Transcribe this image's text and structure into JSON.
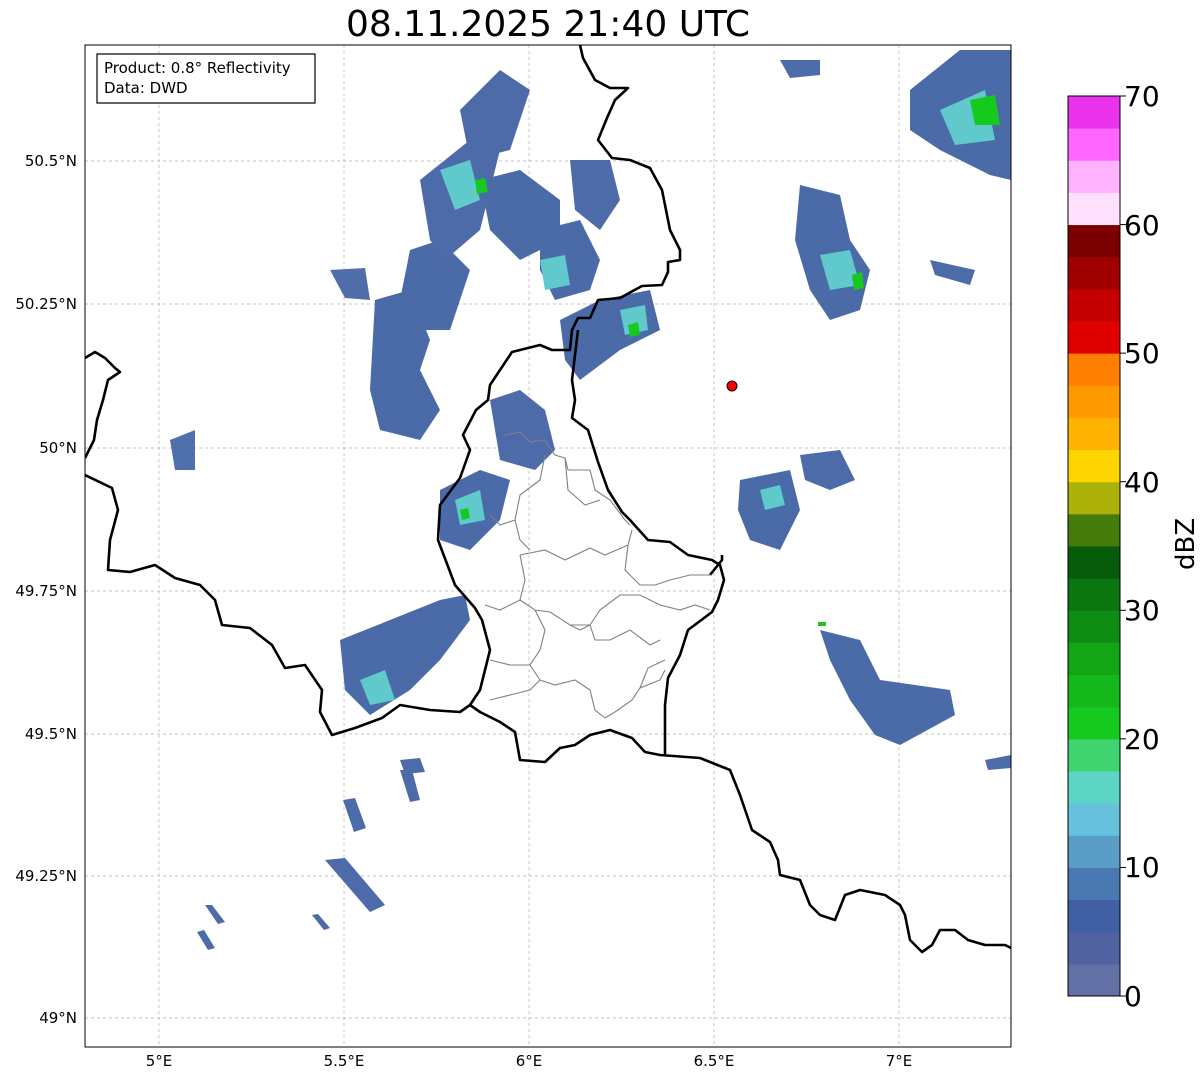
{
  "title": "08.11.2025 21:40 UTC",
  "info_box": {
    "product": "Product: 0.8° Reflectivity",
    "data": "Data: DWD"
  },
  "axes": {
    "x_ticks": [
      "5°E",
      "5.5°E",
      "6°E",
      "6.5°E",
      "7°E"
    ],
    "y_ticks": [
      "50.5°N",
      "50.25°N",
      "50°N",
      "49.75°N",
      "49.5°N",
      "49.25°N",
      "49°N"
    ],
    "lon_range": [
      4.8,
      7.3
    ],
    "lat_range": [
      48.95,
      50.7
    ]
  },
  "colorbar": {
    "label": "dBZ",
    "ticks": [
      "70",
      "60",
      "50",
      "40",
      "30",
      "20",
      "10",
      "0"
    ],
    "colors": [
      "#6270a6",
      "#50629f",
      "#4060a3",
      "#4a78b0",
      "#5a9dc6",
      "#66c1dc",
      "#5dd5c5",
      "#3fd46f",
      "#16c91e",
      "#14b81a",
      "#12a516",
      "#0f8c13",
      "#0b7510",
      "#065c0a",
      "#457b0a",
      "#acb20a",
      "#ffd500",
      "#ffb300",
      "#ff9900",
      "#ff7f00",
      "#e00000",
      "#c40000",
      "#a10000",
      "#7d0000",
      "#ffe0ff",
      "#ffb3ff",
      "#ff66ff",
      "#ea33ea"
    ]
  },
  "radar_marker_color": "#ff0000"
}
